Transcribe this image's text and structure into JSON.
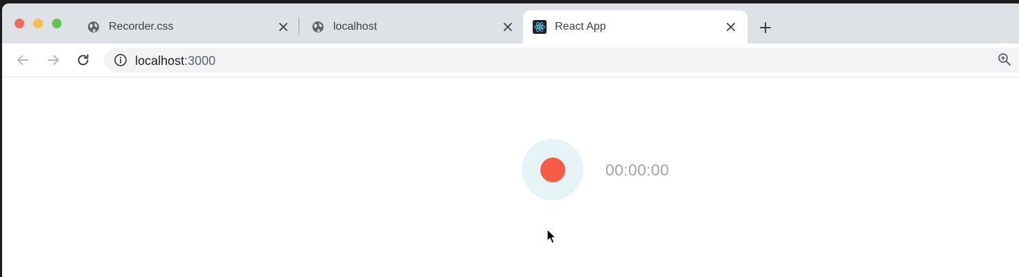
{
  "tabs": [
    {
      "title": "Recorder.css",
      "favicon": "globe-icon",
      "active": false
    },
    {
      "title": "localhost",
      "favicon": "globe-icon",
      "active": false
    },
    {
      "title": "React App",
      "favicon": "react-icon",
      "active": true
    }
  ],
  "omnibox": {
    "host": "localhost",
    "port": ":3000"
  },
  "recorder": {
    "timer": "00:00:00"
  },
  "colors": {
    "record_red": "#f55d46",
    "record_bg": "#e6f4f7",
    "timer_gray": "#a0a4a8"
  }
}
